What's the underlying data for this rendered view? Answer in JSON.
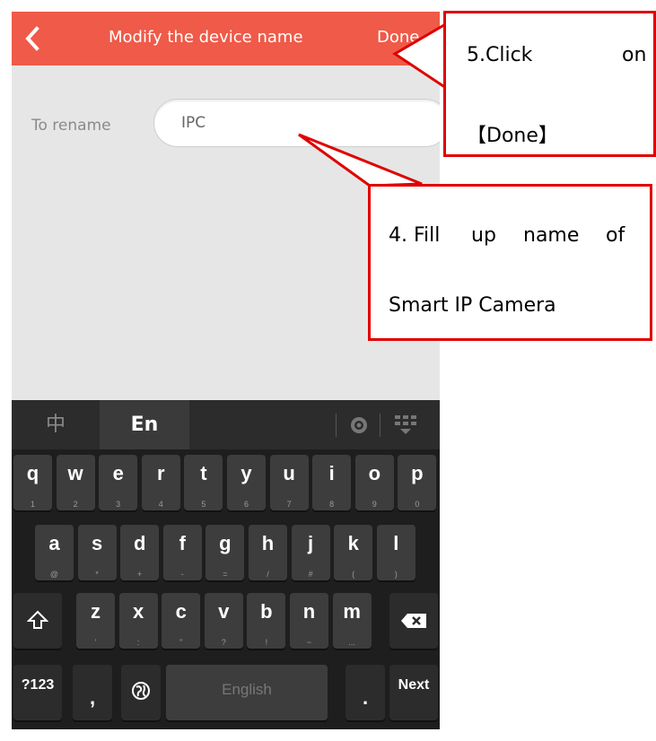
{
  "header": {
    "title": "Modify the device name",
    "done_label": "Done"
  },
  "form": {
    "rename_label": "To rename",
    "name_value": "IPC"
  },
  "keyboard": {
    "tab_zh": "中",
    "tab_en": "En",
    "row1": [
      {
        "k": "q",
        "s": "1"
      },
      {
        "k": "w",
        "s": "2"
      },
      {
        "k": "e",
        "s": "3"
      },
      {
        "k": "r",
        "s": "4"
      },
      {
        "k": "t",
        "s": "5"
      },
      {
        "k": "y",
        "s": "6"
      },
      {
        "k": "u",
        "s": "7"
      },
      {
        "k": "i",
        "s": "8"
      },
      {
        "k": "o",
        "s": "9"
      },
      {
        "k": "p",
        "s": "0"
      }
    ],
    "row2": [
      {
        "k": "a",
        "s": "@"
      },
      {
        "k": "s",
        "s": "*"
      },
      {
        "k": "d",
        "s": "+"
      },
      {
        "k": "f",
        "s": "-"
      },
      {
        "k": "g",
        "s": "="
      },
      {
        "k": "h",
        "s": "/"
      },
      {
        "k": "j",
        "s": "#"
      },
      {
        "k": "k",
        "s": "("
      },
      {
        "k": "l",
        "s": ")"
      }
    ],
    "row3": [
      {
        "k": "z",
        "s": "'"
      },
      {
        "k": "x",
        "s": ":"
      },
      {
        "k": "c",
        "s": "\""
      },
      {
        "k": "v",
        "s": "?"
      },
      {
        "k": "b",
        "s": "!"
      },
      {
        "k": "n",
        "s": "~"
      },
      {
        "k": "m",
        "s": "..."
      }
    ],
    "symbols_label": "?123",
    "comma": ",",
    "space_label": "English",
    "period": ".",
    "next_label": "Next"
  },
  "annotations": {
    "step5_line1": "5.Click",
    "step5_on": "on",
    "step5_line2": "【Done】",
    "step4_line1_a": "4. Fill",
    "step4_line1_b": "up",
    "step4_line1_c": "name",
    "step4_line1_d": "of",
    "step4_line2": "Smart IP Camera"
  },
  "colors": {
    "accent": "#ef5a49",
    "annotation_red": "#e00000",
    "keyboard_bg": "#1e1e1e"
  }
}
